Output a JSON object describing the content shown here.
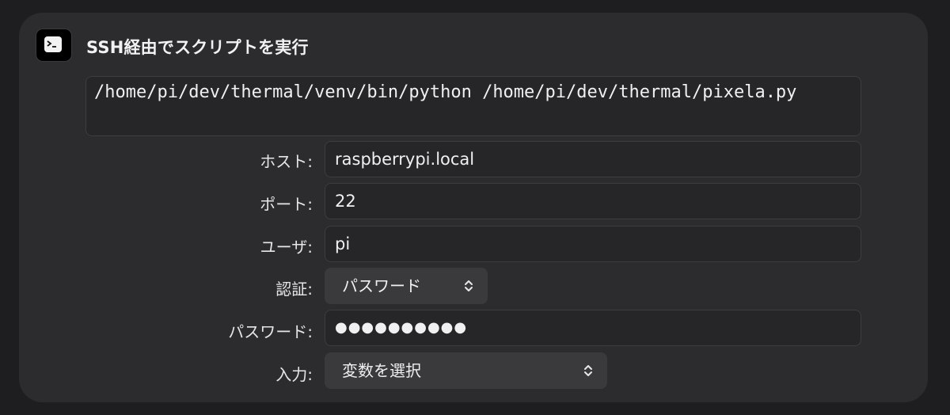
{
  "action": {
    "title": "SSH経由でスクリプトを実行",
    "icon": "terminal-icon"
  },
  "script": {
    "text": "/home/pi/dev/thermal/venv/bin/python /home/pi/dev/thermal/pixela.py"
  },
  "fields": {
    "host": {
      "label": "ホスト:",
      "value": "raspberrypi.local"
    },
    "port": {
      "label": "ポート:",
      "value": "22"
    },
    "user": {
      "label": "ユーザ:",
      "value": "pi"
    },
    "auth": {
      "label": "認証:",
      "value": "パスワード"
    },
    "password": {
      "label": "パスワード:",
      "value": "●●●●●●●●●●"
    },
    "input": {
      "label": "入力:",
      "value": "変数を選択"
    }
  },
  "colors": {
    "background": "#1e1e20",
    "card": "#2c2c2e",
    "field": "#262628",
    "popup": "#3a3a3c",
    "text": "#f0f0f0"
  }
}
